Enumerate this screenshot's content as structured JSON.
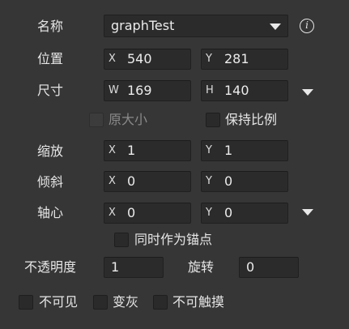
{
  "name": {
    "label": "名称",
    "value": "graphTest"
  },
  "position": {
    "label": "位置",
    "x_axis": "X",
    "x": "540",
    "y_axis": "Y",
    "y": "281"
  },
  "size": {
    "label": "尺寸",
    "w_axis": "W",
    "w": "169",
    "h_axis": "H",
    "h": "140"
  },
  "original_size": {
    "label": "原大小",
    "checked": false,
    "disabled": true
  },
  "keep_ratio": {
    "label": "保持比例",
    "checked": false
  },
  "scale": {
    "label": "缩放",
    "x_axis": "X",
    "x": "1",
    "y_axis": "Y",
    "y": "1"
  },
  "skew": {
    "label": "倾斜",
    "x_axis": "X",
    "x": "0",
    "y_axis": "Y",
    "y": "0"
  },
  "pivot": {
    "label": "轴心",
    "x_axis": "X",
    "x": "0",
    "y_axis": "Y",
    "y": "0"
  },
  "pivot_as_anchor": {
    "label": "同时作为锚点",
    "checked": false
  },
  "opacity": {
    "label": "不透明度",
    "value": "1"
  },
  "rotation": {
    "label": "旋转",
    "value": "0"
  },
  "invisible": {
    "label": "不可见",
    "checked": false
  },
  "grayed": {
    "label": "变灰",
    "checked": false
  },
  "untouchable": {
    "label": "不可触摸",
    "checked": false
  },
  "icons": {
    "info": "i",
    "dropdown": "chevron-down-icon"
  }
}
